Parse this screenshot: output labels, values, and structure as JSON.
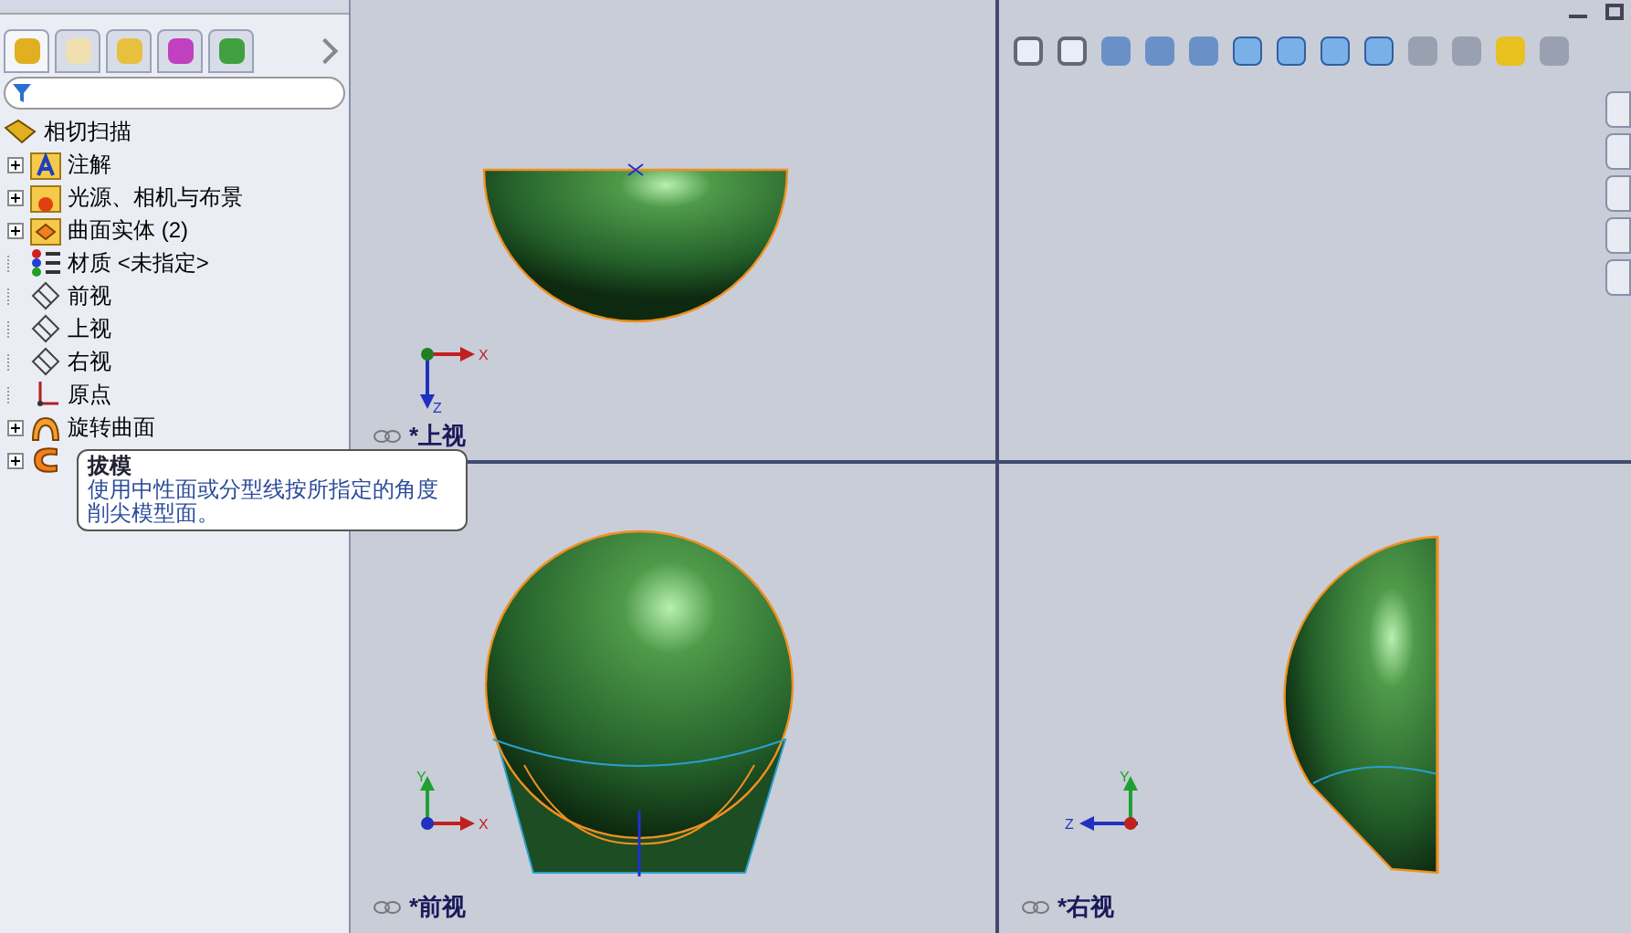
{
  "feature_tree": {
    "root": "相切扫描",
    "items": [
      {
        "label": "注解",
        "kind": "annotation",
        "expandable": true
      },
      {
        "label": "光源、相机与布景",
        "kind": "lights",
        "expandable": true
      },
      {
        "label": "曲面实体 (2)",
        "kind": "surface",
        "expandable": true
      },
      {
        "label": "材质 <未指定>",
        "kind": "material",
        "expandable": false
      },
      {
        "label": "前视",
        "kind": "plane",
        "expandable": false
      },
      {
        "label": "上视",
        "kind": "plane",
        "expandable": false
      },
      {
        "label": "右视",
        "kind": "plane",
        "expandable": false
      },
      {
        "label": "原点",
        "kind": "origin",
        "expandable": false
      },
      {
        "label": "旋转曲面",
        "kind": "revolve",
        "expandable": true
      },
      {
        "kind": "sweep",
        "expandable": true
      }
    ]
  },
  "tooltip": {
    "title": "拔模",
    "body": "使用中性面或分型线按所指定的角度削尖模型面。"
  },
  "viewports": [
    {
      "kind": "top",
      "label": "*上视",
      "axes": [
        "X",
        "Z"
      ]
    },
    {
      "kind": "iso"
    },
    {
      "kind": "front",
      "label": "*前视",
      "axes": [
        "X",
        "Y"
      ]
    },
    {
      "kind": "right",
      "label": "*右视",
      "axes": [
        "Z",
        "Y"
      ]
    }
  ]
}
